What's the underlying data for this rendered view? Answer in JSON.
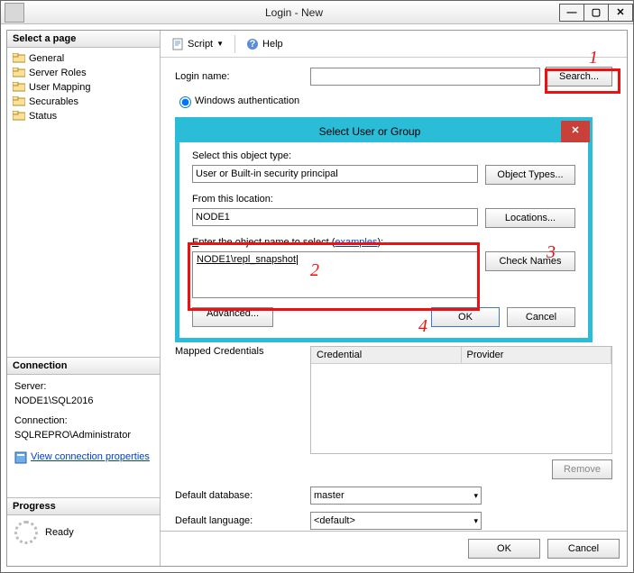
{
  "window": {
    "title": "Login - New"
  },
  "nav": {
    "select_page": "Select a page",
    "items": [
      "General",
      "Server Roles",
      "User Mapping",
      "Securables",
      "Status"
    ]
  },
  "toolbar": {
    "script": "Script",
    "help": "Help"
  },
  "form": {
    "login_name_label": "Login name:",
    "login_name_value": "",
    "search_button": "Search...",
    "auth_windows": "Windows authentication",
    "mapped_credentials": "Mapped Credentials",
    "cred_cols": {
      "credential": "Credential",
      "provider": "Provider"
    },
    "remove": "Remove",
    "default_database_label": "Default database:",
    "default_database_value": "master",
    "default_language_label": "Default language:",
    "default_language_value": "<default>"
  },
  "connection": {
    "heading": "Connection",
    "server_label": "Server:",
    "server_value": "NODE1\\SQL2016",
    "conn_label": "Connection:",
    "conn_value": "SQLREPRO\\Administrator",
    "view_props": "View connection properties"
  },
  "progress": {
    "heading": "Progress",
    "status": "Ready"
  },
  "buttons": {
    "ok": "OK",
    "cancel": "Cancel"
  },
  "modal": {
    "title": "Select User or Group",
    "object_type_label": "Select this object type:",
    "object_type_value": "User or Built-in security principal",
    "object_types_btn": "Object Types...",
    "location_label": "From this location:",
    "location_value": "NODE1",
    "locations_btn": "Locations...",
    "names_label_pre": "Enter the object name to select (",
    "names_label_link": "examples",
    "names_label_post": "):",
    "names_value": "NODE1\\repl_snapshot",
    "check_names": "Check Names",
    "advanced": "Advanced...",
    "ok": "OK",
    "cancel": "Cancel"
  },
  "annotations": {
    "n1": "1",
    "n2": "2",
    "n3": "3",
    "n4": "4"
  }
}
